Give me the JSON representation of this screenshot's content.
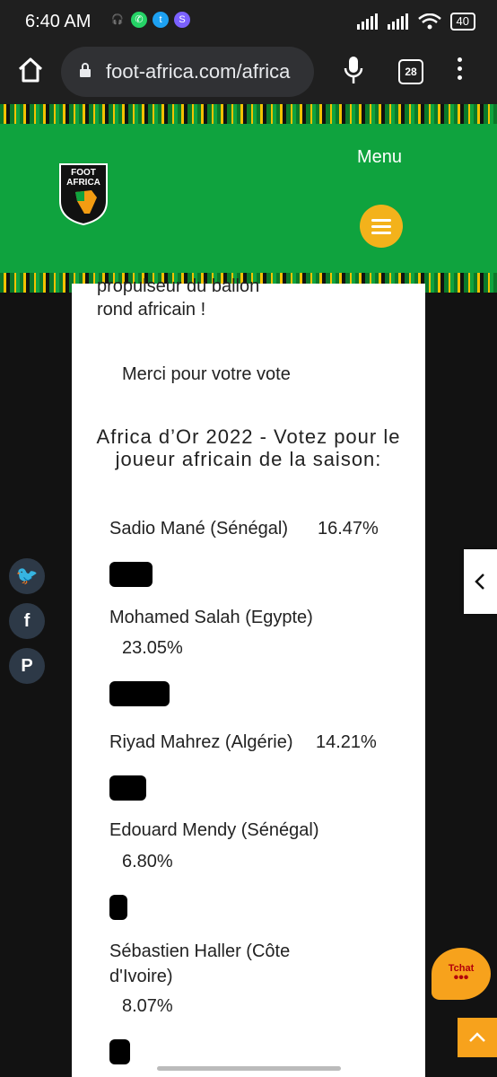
{
  "status_bar": {
    "time": "6:40 AM",
    "battery": "40"
  },
  "browser": {
    "url": "foot-africa.com/africa",
    "tab_count": "28"
  },
  "site": {
    "logo_text_line1": "FOOT",
    "logo_text_line2": "AFRICA",
    "menu_label": "Menu",
    "brand_green": "#0fa33e",
    "accent_yellow": "#f3b21b"
  },
  "article": {
    "intro_line1": "propulseur du ballon",
    "intro_line2": "rond africain !",
    "thanks": "Merci pour votre vote"
  },
  "poll": {
    "title": "Africa d’Or 2022 - Votez pour le joueur africain de la saison:",
    "options": [
      {
        "name": "Sadio Mané (Sénégal)",
        "percent": "16.47%",
        "share": 0.1647
      },
      {
        "name": "Mohamed Salah (Egypte)",
        "percent": "23.05%",
        "share": 0.2305
      },
      {
        "name": "Riyad Mahrez (Algérie)",
        "percent": "14.21%",
        "share": 0.1421
      },
      {
        "name": "Edouard Mendy (Sénégal)",
        "percent": "6.80%",
        "share": 0.068
      },
      {
        "name": "Sébastien Haller (Côte d'Ivoire)",
        "percent": "8.07%",
        "share": 0.0807
      }
    ]
  },
  "social": {
    "twitter_icon": "twitter-icon",
    "facebook_icon": "facebook-icon",
    "pinterest_icon": "pinterest-icon"
  },
  "chat": {
    "label": "Tchat"
  }
}
